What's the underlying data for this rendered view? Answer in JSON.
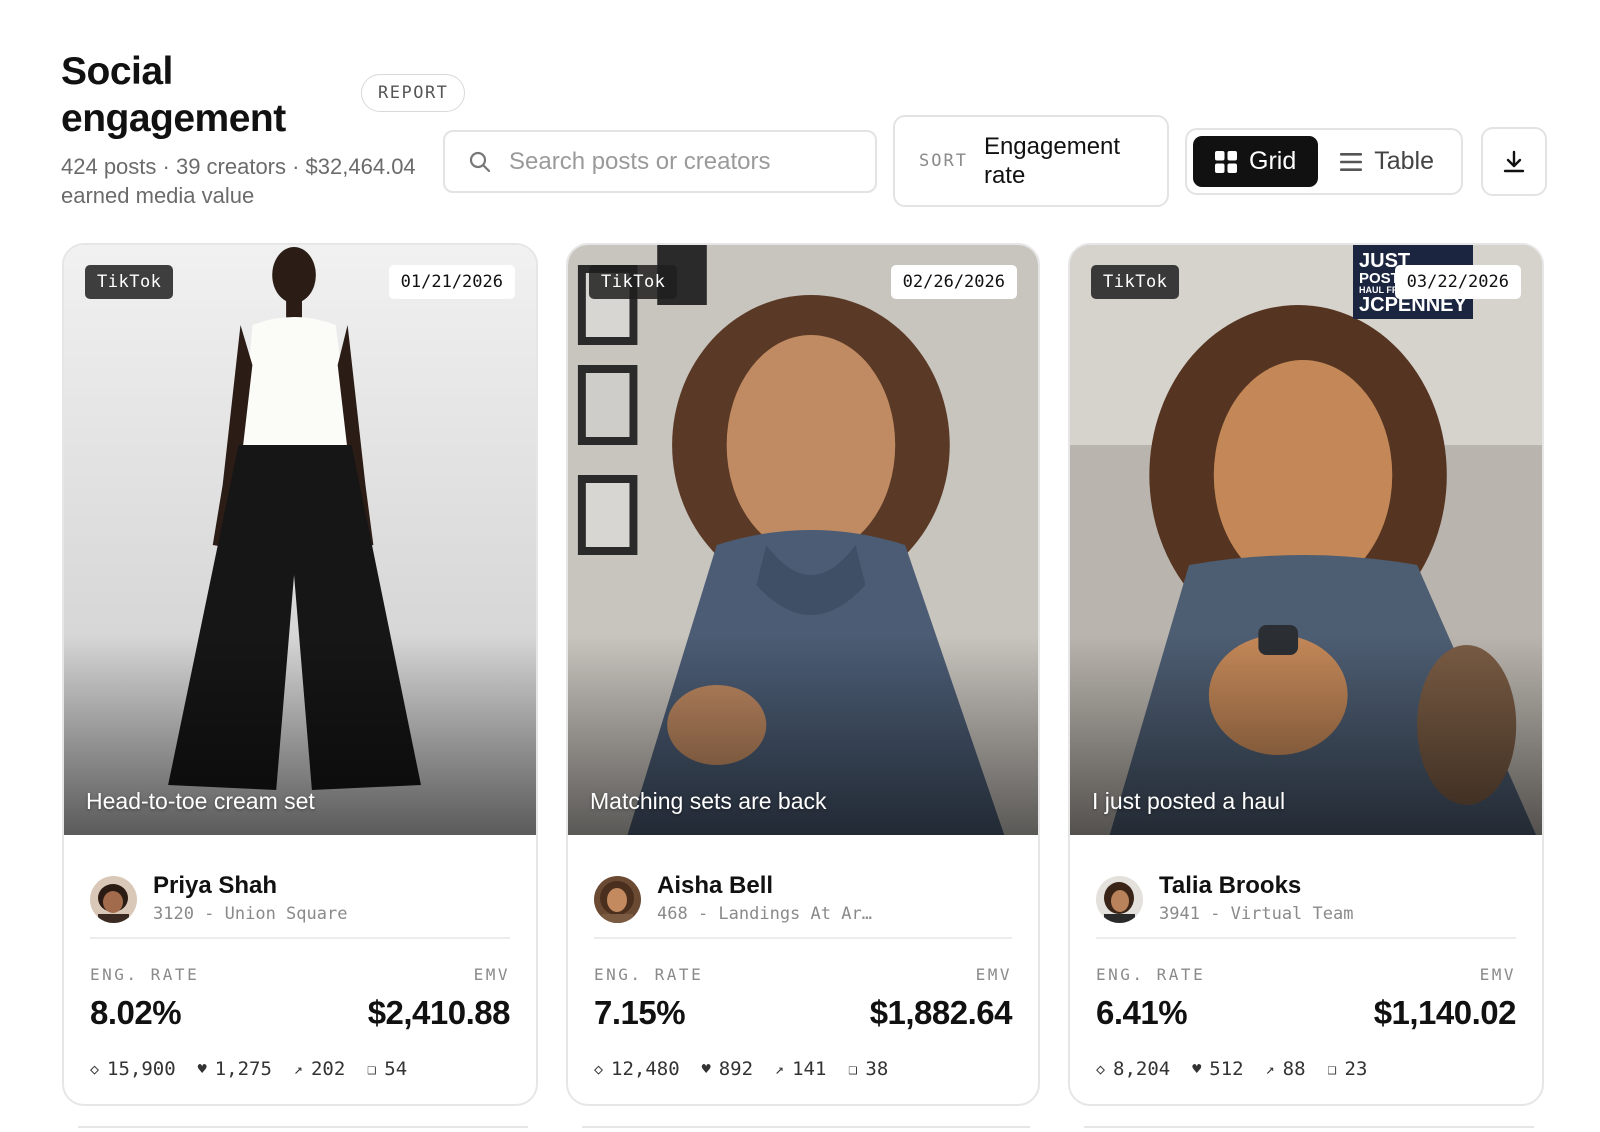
{
  "header": {
    "title": "Social engagement",
    "badge": "REPORT",
    "subtitle": "424 posts · 39 creators · $32,464.04 earned media value"
  },
  "search": {
    "placeholder": "Search posts or creators",
    "value": "",
    "icon": "search-icon"
  },
  "sort": {
    "label": "SORT",
    "value": "Engagement rate"
  },
  "view": {
    "grid_label": "Grid",
    "table_label": "Table",
    "selected": "Grid",
    "grid_icon": "grid-icon",
    "table_icon": "list-icon"
  },
  "download": {
    "icon": "download-icon"
  },
  "cards": [
    {
      "platform": "TikTok",
      "date": "01/21/2026",
      "caption": "Head-to-toe cream set",
      "creator_name": "Priya Shah",
      "creator_store": "3120 - Union Square",
      "eng_label": "ENG. RATE",
      "eng_value": "8.02%",
      "emv_label": "EMV",
      "emv_value": "$2,410.88",
      "views": "15,900",
      "likes": "1,275",
      "shares": "202",
      "comments": "54"
    },
    {
      "platform": "TikTok",
      "date": "02/26/2026",
      "caption": "Matching sets are back",
      "creator_name": "Aisha Bell",
      "creator_store": "468 - Landings At Ar…",
      "eng_label": "ENG. RATE",
      "eng_value": "7.15%",
      "emv_label": "EMV",
      "emv_value": "$1,882.64",
      "views": "12,480",
      "likes": "892",
      "shares": "141",
      "comments": "38"
    },
    {
      "platform": "TikTok",
      "date": "03/22/2026",
      "caption": "I just posted a haul",
      "creator_name": "Talia Brooks",
      "creator_store": "3941 - Virtual Team",
      "eng_label": "ENG. RATE",
      "eng_value": "6.41%",
      "emv_label": "EMV",
      "emv_value": "$1,140.02",
      "views": "8,204",
      "likes": "512",
      "shares": "88",
      "comments": "23",
      "overlay_text": [
        "JUST",
        "POST",
        "HAUL FR",
        "JCPENNEY"
      ]
    }
  ],
  "stat_icons": {
    "views": "◇",
    "likes": "♥",
    "shares": "↗",
    "comments": "❑"
  }
}
